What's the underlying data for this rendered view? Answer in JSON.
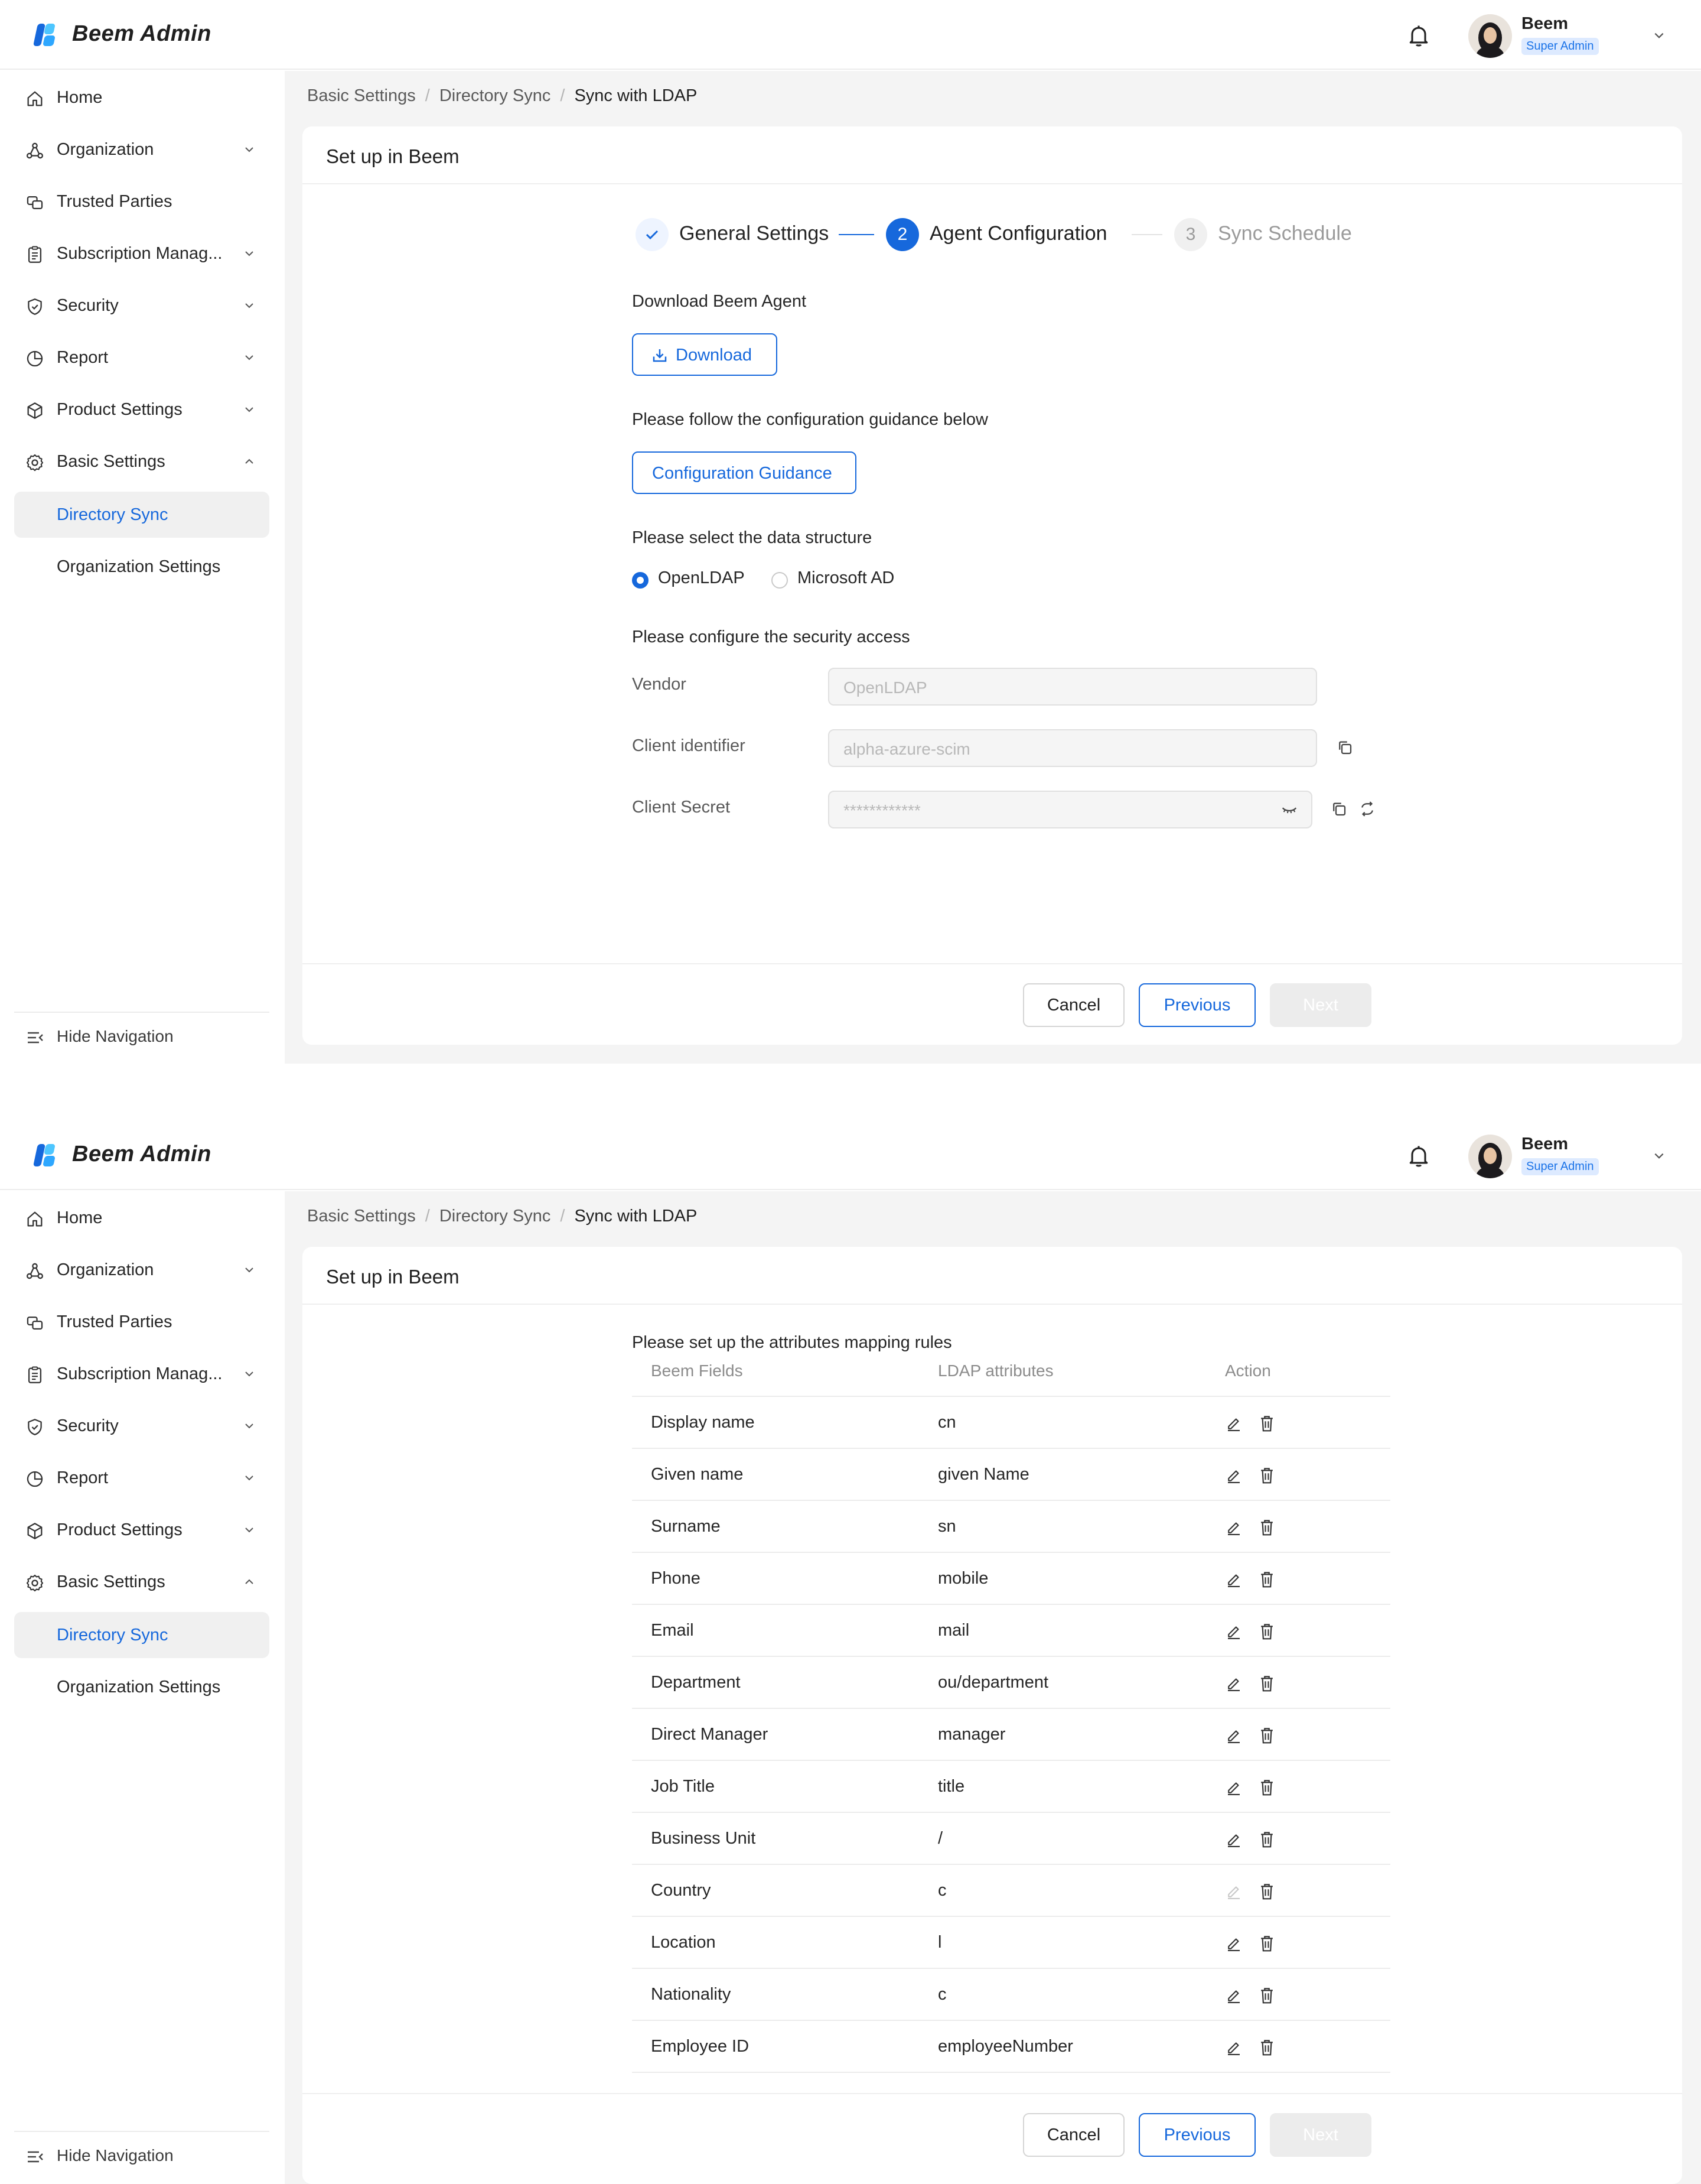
{
  "app": {
    "title": "Beem Admin",
    "brand_colors": [
      "#1668dc",
      "#2ea7ff",
      "#4dc6ff"
    ]
  },
  "user": {
    "name": "Beem",
    "role": "Super Admin"
  },
  "sidebar": {
    "items": [
      {
        "label": "Home",
        "icon": "home-icon"
      },
      {
        "label": "Organization",
        "icon": "organization-icon",
        "chevron": "down"
      },
      {
        "label": "Trusted Parties",
        "icon": "trusted-parties-icon"
      },
      {
        "label": "Subscription Manag...",
        "icon": "subscription-icon",
        "chevron": "down"
      },
      {
        "label": "Security",
        "icon": "shield-icon",
        "chevron": "down"
      },
      {
        "label": "Report",
        "icon": "report-icon",
        "chevron": "down"
      },
      {
        "label": "Product Settings",
        "icon": "box-icon",
        "chevron": "down"
      },
      {
        "label": "Basic Settings",
        "icon": "gear-icon",
        "chevron": "up"
      }
    ],
    "subitems": [
      {
        "label": "Directory Sync",
        "active": true
      },
      {
        "label": "Organization Settings",
        "active": false
      }
    ],
    "hide_nav": "Hide Navigation"
  },
  "breadcrumb": [
    "Basic Settings",
    "Directory Sync",
    "Sync with LDAP"
  ],
  "card_title": "Set up in Beem",
  "steps": [
    {
      "number": "1",
      "label": "General Settings",
      "state": "done"
    },
    {
      "number": "2",
      "label": "Agent Configuration",
      "state": "active"
    },
    {
      "number": "3",
      "label": "Sync Schedule",
      "state": "pending"
    }
  ],
  "agent": {
    "download_heading": "Download Beem Agent",
    "download_button": "Download",
    "guidance_heading": "Please follow the configuration guidance below",
    "guidance_button": "Configuration Guidance",
    "structure_heading": "Please select the data structure",
    "structure_options": [
      {
        "label": "OpenLDAP",
        "selected": true
      },
      {
        "label": "Microsoft AD",
        "selected": false
      }
    ],
    "security_heading": "Please configure the security access",
    "fields": {
      "vendor_label": "Vendor",
      "vendor_value": "OpenLDAP",
      "client_id_label": "Client identifier",
      "client_id_value": "alpha-azure-scim",
      "client_secret_label": "Client Secret",
      "client_secret_value": "************"
    }
  },
  "mapping": {
    "heading": "Please set up the attributes mapping rules",
    "columns": [
      "Beem Fields",
      "LDAP attributes",
      "Action"
    ],
    "rows": [
      {
        "field": "Display name",
        "attr": "cn",
        "edit_enabled": true
      },
      {
        "field": "Given name",
        "attr": "given Name",
        "edit_enabled": true
      },
      {
        "field": "Surname",
        "attr": "sn",
        "edit_enabled": true
      },
      {
        "field": "Phone",
        "attr": "mobile",
        "edit_enabled": true
      },
      {
        "field": "Email",
        "attr": "mail",
        "edit_enabled": true
      },
      {
        "field": "Department",
        "attr": "ou/department",
        "edit_enabled": true
      },
      {
        "field": "Direct Manager",
        "attr": "manager",
        "edit_enabled": true
      },
      {
        "field": "Job Title",
        "attr": "title",
        "edit_enabled": true
      },
      {
        "field": "Business Unit",
        "attr": "/",
        "edit_enabled": true
      },
      {
        "field": "Country",
        "attr": "c",
        "edit_enabled": false
      },
      {
        "field": "Location",
        "attr": "l",
        "edit_enabled": true
      },
      {
        "field": "Nationality",
        "attr": "c",
        "edit_enabled": true
      },
      {
        "field": "Employee ID",
        "attr": "employeeNumber",
        "edit_enabled": true
      }
    ]
  },
  "footer": {
    "cancel": "Cancel",
    "previous": "Previous",
    "next": "Next"
  }
}
